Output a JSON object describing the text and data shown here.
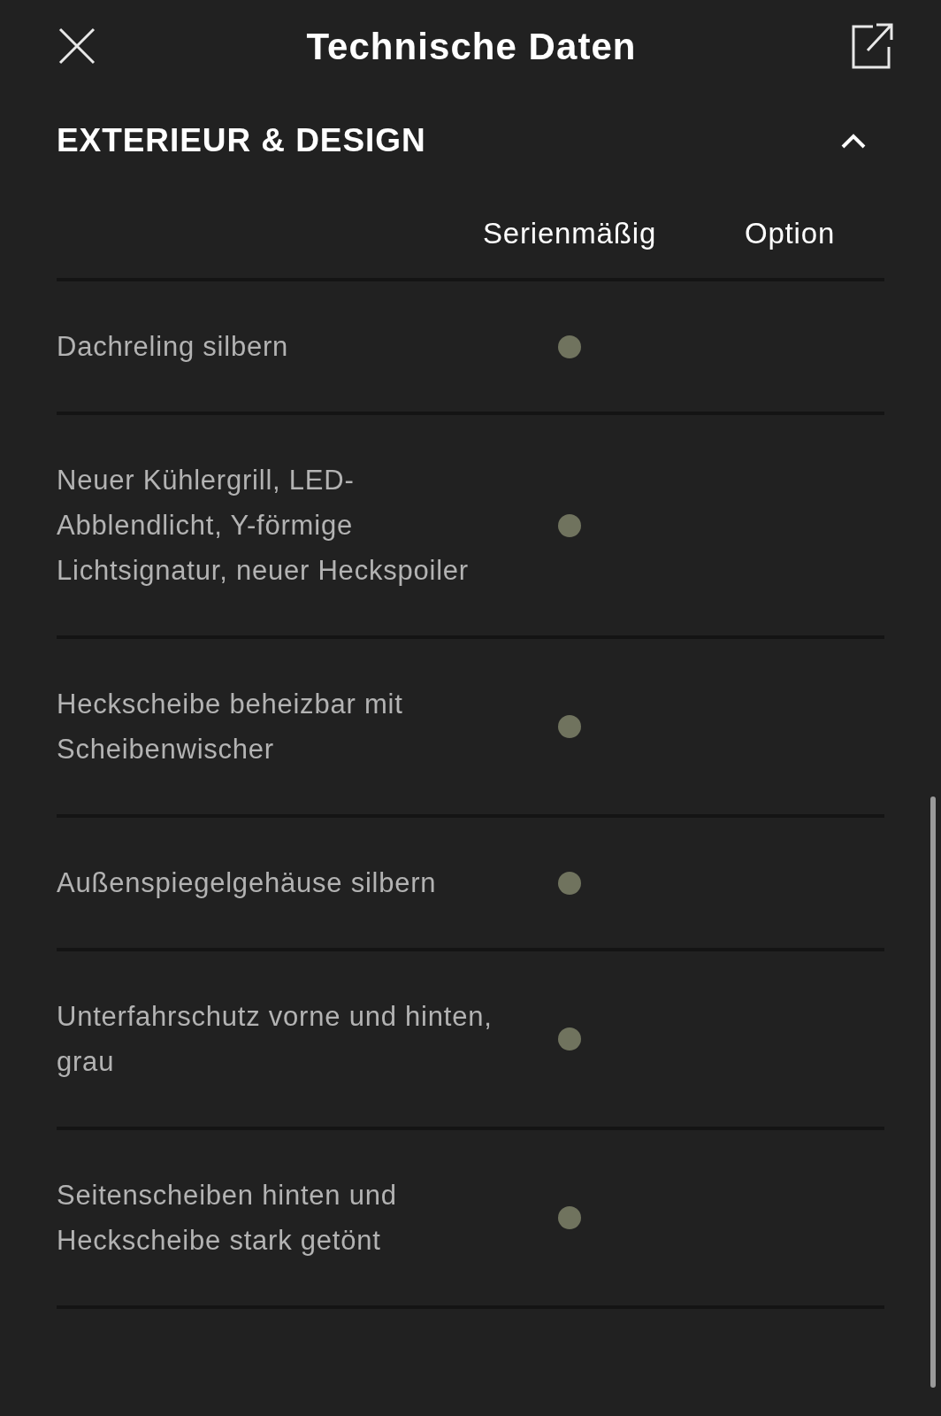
{
  "header": {
    "title": "Technische Daten"
  },
  "section": {
    "title": "EXTERIEUR & DESIGN",
    "expanded": true
  },
  "table": {
    "columns": [
      "Serienmäßig",
      "Option"
    ],
    "rows": [
      {
        "label": "Dachreling silbern",
        "standard": true,
        "option": false
      },
      {
        "label": "Neuer Kühlergrill, LED-Abblendlicht, Y-förmige Lichtsignatur, neuer Heckspoiler",
        "standard": true,
        "option": false
      },
      {
        "label": "Heckscheibe beheizbar mit Scheibenwischer",
        "standard": true,
        "option": false
      },
      {
        "label": "Außenspiegelgehäuse silbern",
        "standard": true,
        "option": false
      },
      {
        "label": "Unterfahrschutz vorne und hinten, grau",
        "standard": true,
        "option": false
      },
      {
        "label": "Seitenscheiben hinten und Heckscheibe stark getönt",
        "standard": true,
        "option": false
      }
    ]
  }
}
